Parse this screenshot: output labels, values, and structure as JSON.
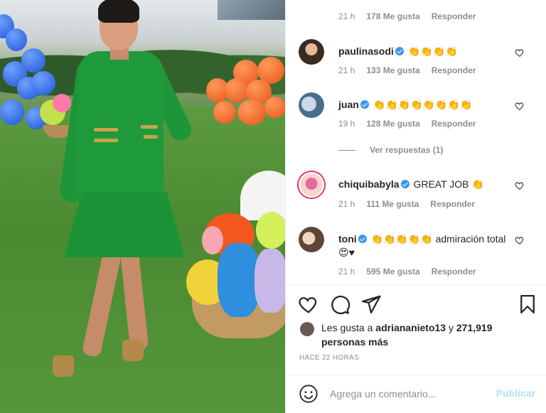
{
  "comments": [
    {
      "time": "21 h",
      "likes": "178 Me gusta",
      "reply": "Responder"
    },
    {
      "user": "paulinasodi",
      "text": "👏👏👏👏",
      "time": "21 h",
      "likes": "133 Me gusta",
      "reply": "Responder"
    },
    {
      "user": "juan",
      "text": "👏👏👏👏👏👏👏👏",
      "time": "19 h",
      "likes": "128 Me gusta",
      "reply": "Responder"
    },
    {
      "user": "chiquibabyla",
      "text": "GREAT JOB 👏",
      "time": "21 h",
      "likes": "111 Me gusta",
      "reply": "Responder"
    },
    {
      "user": "toni",
      "text": "👏👏👏👏👏 admiración total 😍♥",
      "time": "21 h",
      "likes": "595 Me gusta",
      "reply": "Responder"
    }
  ],
  "view_replies": "Ver respuestas (1)",
  "likes_summary": {
    "prefix": "Les gusta a",
    "user": "adriananieto13",
    "joiner": "y",
    "count": "271,919 personas más"
  },
  "post_age": "HACE 22 HORAS",
  "comment_box": {
    "placeholder": "Agrega un comentario...",
    "publish_label": "Publicar"
  },
  "colors": {
    "verified": "#3897f0",
    "publish_disabled": "#b2dffc",
    "muted": "#8e8e8e",
    "dress": "#1f9a3a"
  }
}
